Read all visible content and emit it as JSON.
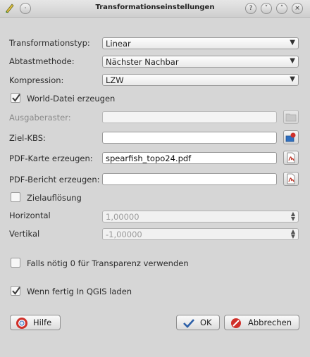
{
  "window": {
    "title": "Transformationseinstellungen"
  },
  "labels": {
    "transformation_type": "Transformationstyp:",
    "sampling_method": "Abtastmethode:",
    "compression": "Kompression:",
    "output_raster": "Ausgaberaster:",
    "target_crs": "Ziel-KBS:",
    "pdf_map": "PDF-Karte erzeugen:",
    "pdf_report": "PDF-Bericht erzeugen:",
    "horizontal": "Horizontal",
    "vertical": "Vertikal"
  },
  "combos": {
    "transformation_type": "Linear",
    "sampling_method": "Nächster Nachbar",
    "compression": "LZW"
  },
  "checkboxes": {
    "world_file": {
      "label": "World-Datei erzeugen",
      "checked": true
    },
    "target_resolution": {
      "label": "Zielauflösung",
      "checked": false
    },
    "transparency": {
      "label": "Falls nötig 0 für Transparenz verwenden",
      "checked": false
    },
    "load_in_qgis": {
      "label": "Wenn fertig In QGIS laden",
      "checked": true
    }
  },
  "fields": {
    "output_raster": "",
    "target_crs": "",
    "pdf_map": "spearfish_topo24.pdf",
    "pdf_report": ""
  },
  "spinboxes": {
    "horizontal": "1,00000",
    "vertical": "-1,00000"
  },
  "buttons": {
    "help": "Hilfe",
    "ok": "OK",
    "cancel": "Abbrechen"
  },
  "colors": {
    "check_green": "#4a9a2a",
    "pdf_red": "#c0392b",
    "crs_blue": "#2f6fc0",
    "cancel_red": "#d0302a"
  }
}
